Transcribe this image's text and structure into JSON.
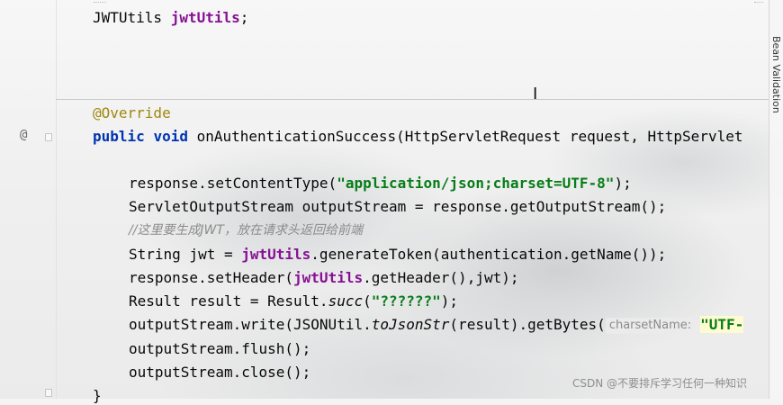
{
  "editor": {
    "lines": {
      "l1": {
        "type": "JWTUtils",
        "field": "jwtUtils",
        "end": ";"
      },
      "l2": {
        "annotation": "@Override"
      },
      "l3": {
        "kw_public": "public",
        "kw_void": "void",
        "rest": "onAuthenticationSuccess(HttpServletRequest request, HttpServlet"
      },
      "l4": {
        "pre": "response.setContentType(",
        "str": "\"application/json;charset=UTF-8\"",
        "post": ");"
      },
      "l5": {
        "text": "ServletOutputStream outputStream = response.getOutputStream();"
      },
      "l6": {
        "comment": "//这里要生成JWT，放在请求头返回给前端"
      },
      "l7": {
        "pre": "String jwt = ",
        "field": "jwtUtils",
        "post": ".generateToken(authentication.getName());"
      },
      "l8": {
        "pre": "response.setHeader(",
        "field": "jwtUtils",
        "post": ".getHeader(),jwt);"
      },
      "l9": {
        "pre": "Result result = Result.",
        "method": "succ",
        "mid": "(",
        "str": "\"??????\"",
        "post": ");"
      },
      "l10": {
        "pre": "outputStream.write(JSONUtil.",
        "method": "toJsonStr",
        "mid": "(result).getBytes(",
        "hint": "charsetName:",
        "str": "\"UTF-"
      },
      "l11": {
        "text": "outputStream.flush();"
      },
      "l12": {
        "text": "outputStream.close();"
      },
      "l13": {
        "text": "}"
      }
    },
    "gutter_icon": "@"
  },
  "right_panel": {
    "label": "Bean Validation"
  },
  "watermark": "CSDN @不要排斥学习任何一种知识",
  "colors": {
    "keyword": "#0033b3",
    "annotation": "#9e880d",
    "string": "#067d17",
    "field": "#871094",
    "comment": "#8c8c8c"
  },
  "icons": {
    "gutter": "override-at-icon",
    "cursor": "text-cursor-icon"
  }
}
